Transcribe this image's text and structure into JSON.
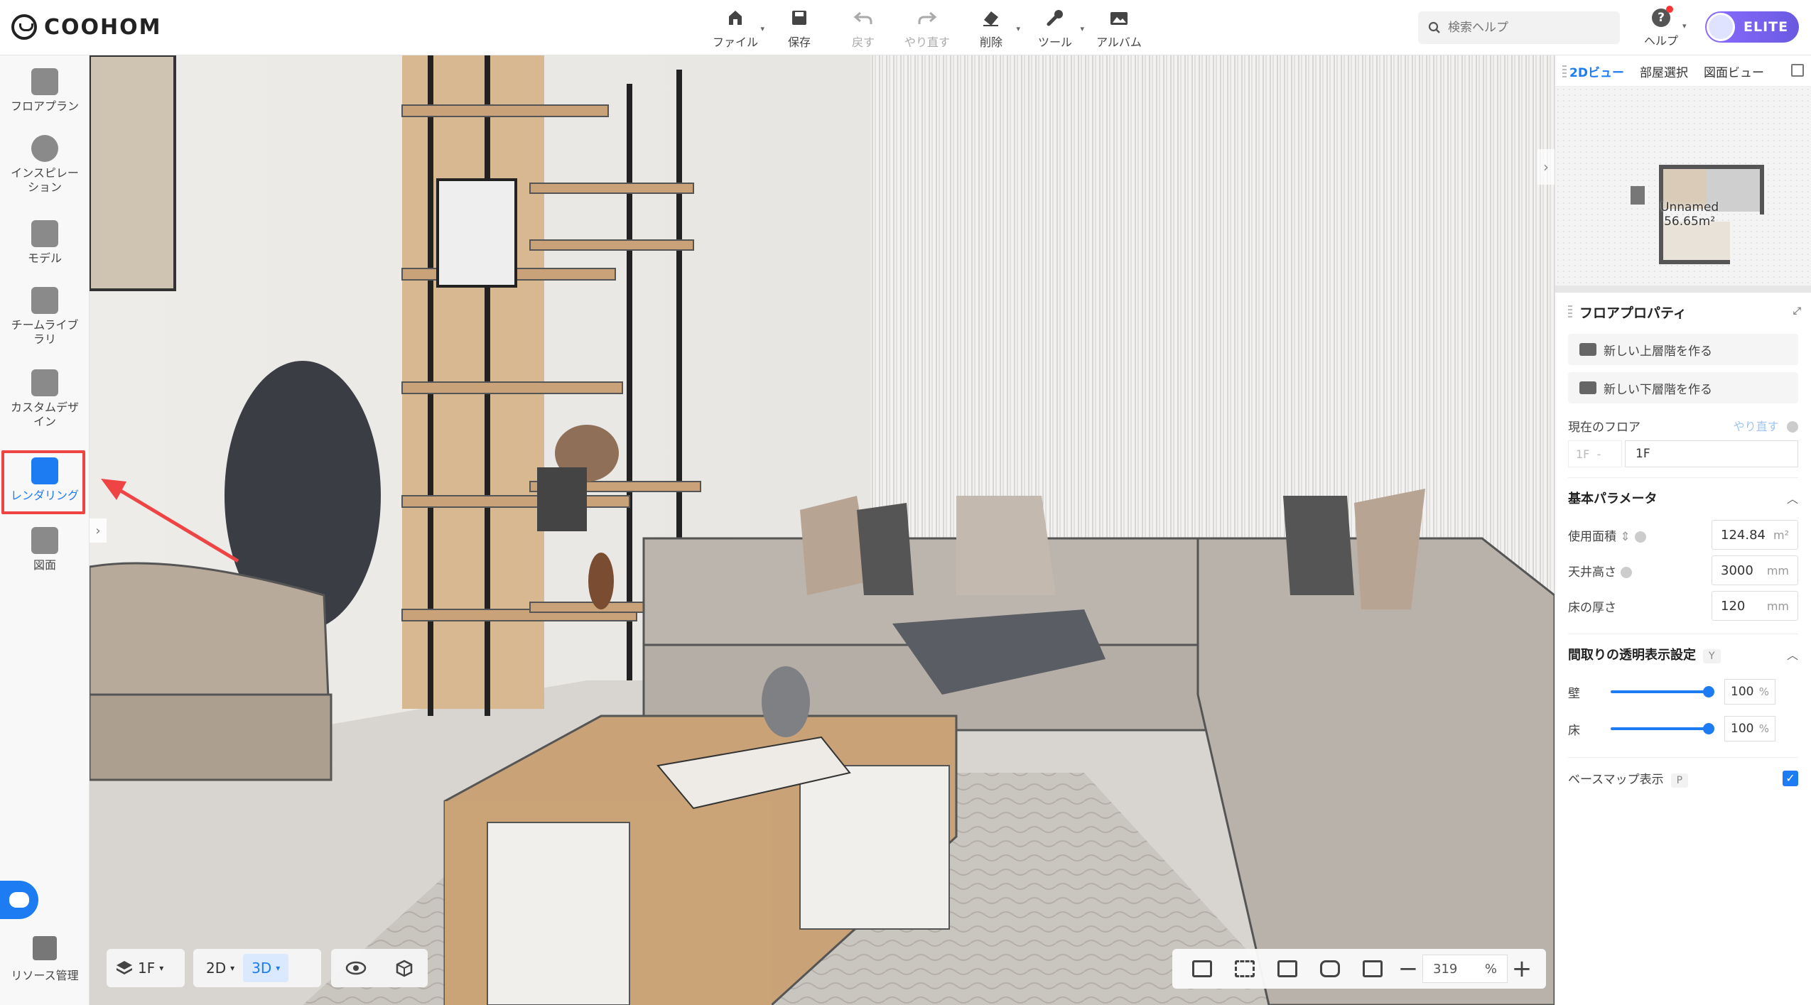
{
  "app": {
    "logo": "COOHOM"
  },
  "toolbar": [
    {
      "label": "ファイル",
      "icon": "file-icon",
      "caret": true,
      "disabled": false
    },
    {
      "label": "保存",
      "icon": "save-icon",
      "caret": false,
      "disabled": false
    },
    {
      "label": "戻す",
      "icon": "undo-icon",
      "caret": false,
      "disabled": true
    },
    {
      "label": "やり直す",
      "icon": "redo-icon",
      "caret": false,
      "disabled": true
    },
    {
      "label": "削除",
      "icon": "eraser-icon",
      "caret": true,
      "disabled": false
    },
    {
      "label": "ツール",
      "icon": "wrench-icon",
      "caret": true,
      "disabled": false
    },
    {
      "label": "アルバム",
      "icon": "album-icon",
      "caret": false,
      "disabled": false
    }
  ],
  "search": {
    "placeholder": "検索ヘルプ"
  },
  "help": {
    "label": "ヘルプ"
  },
  "account": {
    "badge": "ELITE"
  },
  "sidebar": {
    "items": [
      {
        "label": "フロアプラン"
      },
      {
        "label": "インスピレーション"
      },
      {
        "label": "モデル"
      },
      {
        "label": "チームライブラリ"
      },
      {
        "label": "カスタムデザイン"
      },
      {
        "label": "レンダリング"
      },
      {
        "label": "図面"
      }
    ],
    "resource_label": "リソース管理"
  },
  "bottom_left": {
    "floor": "1F",
    "view_2d": "2D",
    "view_3d": "3D"
  },
  "zoom": {
    "value": "319",
    "unit": "%"
  },
  "right_panel": {
    "tabs": [
      "2Dビュー",
      "部屋選択",
      "図面ビュー"
    ],
    "minimap": {
      "room_name": "Unnamed",
      "room_area": "56.65m²"
    },
    "props_title": "フロアプロパティ",
    "btn_upper": "新しい上層階を作る",
    "btn_lower": "新しい下層階を作る",
    "current_floor_label": "現在のフロア",
    "current_floor_redo": "やり直す",
    "floor_prefix": "1F",
    "floor_sep": "-",
    "floor_value": "1F",
    "basic_params_title": "基本パラメータ",
    "usage_area_label": "使用面積",
    "usage_area_value": "124.84",
    "usage_area_unit": "m²",
    "ceiling_label": "天井高さ",
    "ceiling_value": "3000",
    "ceiling_unit": "mm",
    "floor_thick_label": "床の厚さ",
    "floor_thick_value": "120",
    "floor_thick_unit": "mm",
    "transparency_title": "間取りの透明表示設定",
    "transparency_key": "Y",
    "wall_label": "壁",
    "wall_value": "100",
    "floor_label": "床",
    "floor_value_pct": "100",
    "pct_unit": "%",
    "basemap_label": "ベースマップ表示",
    "basemap_key": "P",
    "basemap_checked": true
  }
}
